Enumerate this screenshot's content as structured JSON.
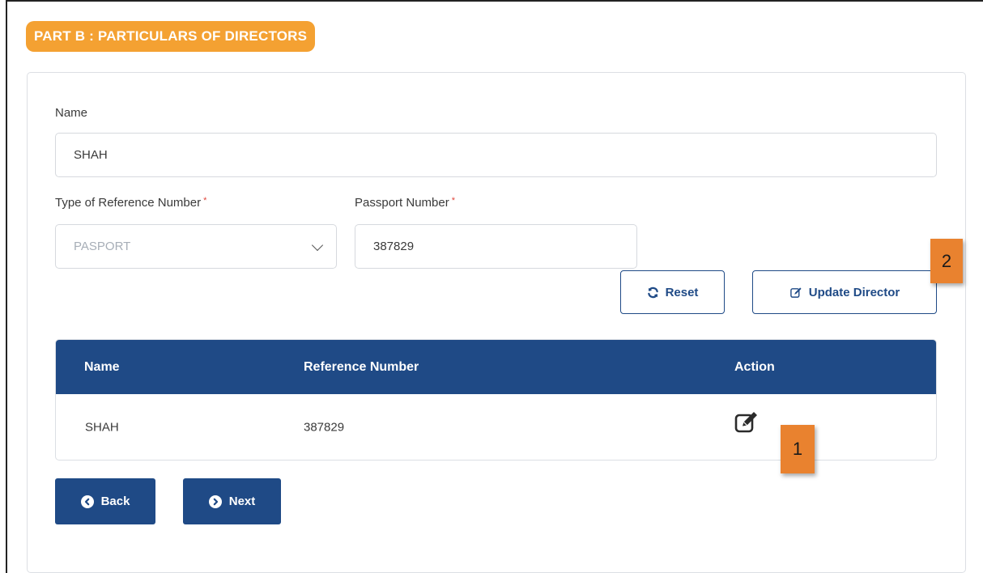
{
  "section": {
    "title": "PART B : PARTICULARS OF DIRECTORS"
  },
  "form": {
    "name_label": "Name",
    "name_value": "SHAH",
    "ref_type_label": "Type of Reference Number",
    "ref_type_value": "PASPORT",
    "passport_label": "Passport Number",
    "passport_value": "387829",
    "required_mark": "*"
  },
  "actions": {
    "reset_label": "Reset",
    "update_label": "Update Director"
  },
  "table": {
    "headers": [
      "Name",
      "Reference Number",
      "Action"
    ],
    "rows": [
      {
        "name": "SHAH",
        "reference": "387829"
      }
    ]
  },
  "nav": {
    "back_label": "Back",
    "next_label": "Next"
  },
  "annotations": {
    "edit_marker": "1",
    "update_marker": "2"
  },
  "colors": {
    "accent_orange": "#f4a132",
    "primary_blue": "#1f4a86",
    "marker_orange": "#e9822f",
    "required_red": "#e0463c"
  }
}
